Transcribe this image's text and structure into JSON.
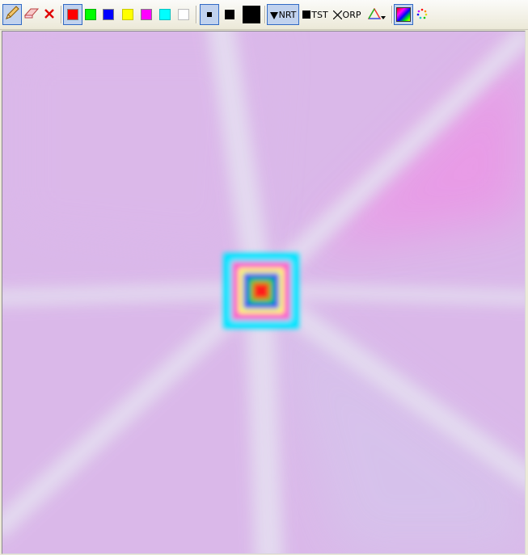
{
  "toolbar": {
    "tools": [
      {
        "name": "pencil",
        "icon": "pencil-icon",
        "selected": true
      },
      {
        "name": "eraser",
        "icon": "eraser-icon",
        "selected": false
      },
      {
        "name": "clear",
        "icon": "close-icon",
        "selected": false
      }
    ],
    "colors": [
      {
        "name": "red",
        "hex": "#ff0000",
        "selected": true
      },
      {
        "name": "green",
        "hex": "#00ff00",
        "selected": false
      },
      {
        "name": "blue",
        "hex": "#0000ff",
        "selected": false
      },
      {
        "name": "yellow",
        "hex": "#ffff00",
        "selected": false
      },
      {
        "name": "magenta",
        "hex": "#ff00ff",
        "selected": false
      },
      {
        "name": "cyan",
        "hex": "#00ffff",
        "selected": false
      },
      {
        "name": "white",
        "hex": "#ffffff",
        "selected": false
      }
    ],
    "brush_sizes": [
      {
        "name": "small",
        "selected": true
      },
      {
        "name": "medium",
        "selected": false
      },
      {
        "name": "large",
        "selected": false
      }
    ],
    "modes": [
      {
        "name": "nrt",
        "label": "NRT",
        "icon": "triangle-down-icon",
        "selected": true
      },
      {
        "name": "tst",
        "label": "TST",
        "icon": "square-icon",
        "selected": false
      },
      {
        "name": "orp",
        "label": "ORP",
        "icon": "cross-icon",
        "selected": false
      }
    ],
    "color_menu_icon": "rgb-triangle-icon",
    "gradient_icon": "color-gradient-icon",
    "dots_icon": "color-dots-icon"
  },
  "canvas": {
    "background": "#dab8e9",
    "ray_color": "#e4dcf0",
    "square_colors": [
      "#00e5ff",
      "#ff55cc",
      "#ffff55",
      "#0033ff",
      "#00cc33",
      "#ff1a1a"
    ]
  }
}
